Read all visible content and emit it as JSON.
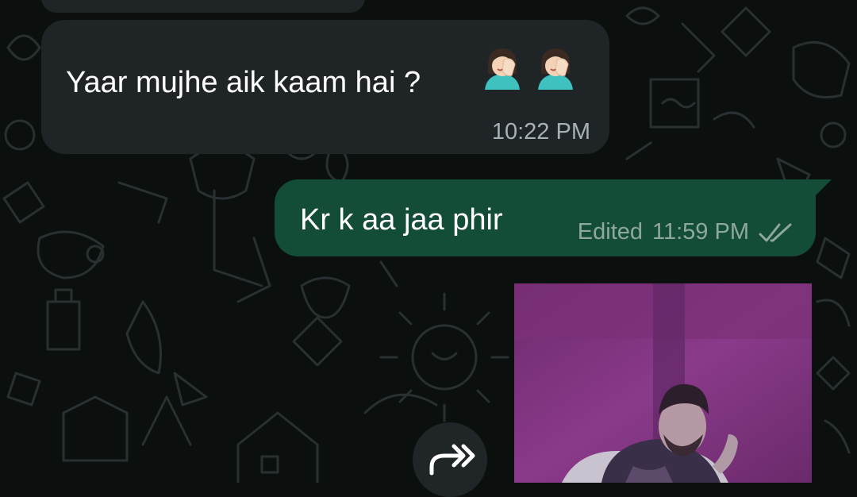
{
  "chat": {
    "incoming": {
      "text": "Yaar mujhe aik kaam hai ?",
      "emojis": [
        "facepalm-woman-emoji",
        "facepalm-woman-emoji"
      ],
      "time": "10:22 PM"
    },
    "outgoing": {
      "text": "Kr k aa jaa phir",
      "edited_label": "Edited",
      "time": "11:59 PM",
      "status_icon": "double-check-icon"
    },
    "media": {
      "type": "image",
      "description_icon": "video-thumbnail"
    },
    "forward": {
      "icon": "forward-icon"
    }
  },
  "colors": {
    "background": "#0b0f0e",
    "incoming_bubble": "#1f2427",
    "outgoing_bubble": "#144d37",
    "meta_text": "#a7b0b5"
  }
}
